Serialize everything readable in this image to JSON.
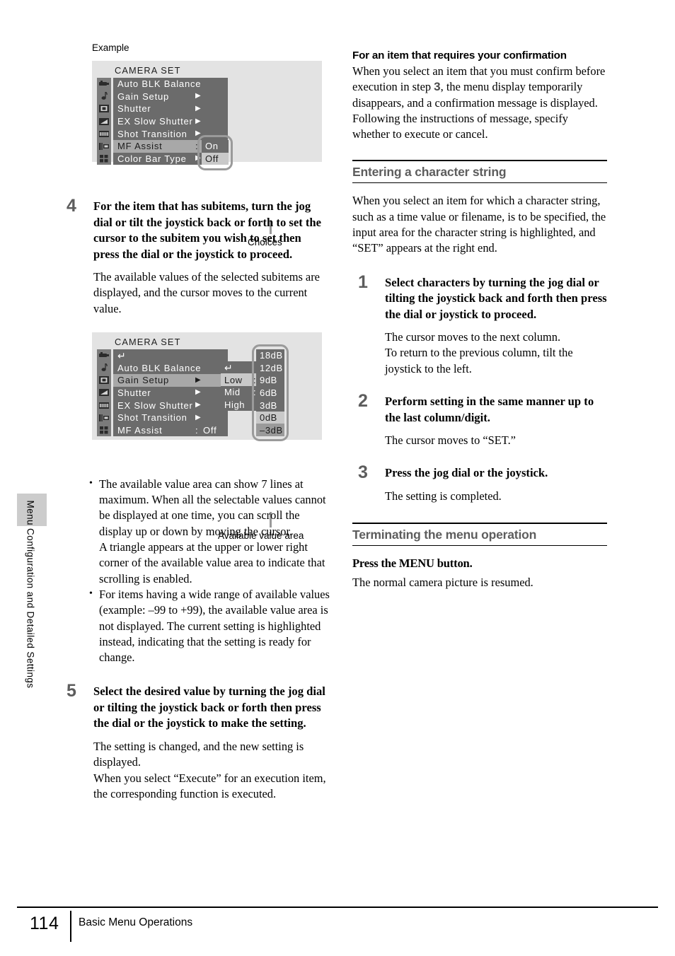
{
  "sidebar": {
    "chapter_label": "Menu Configuration and Detailed Settings"
  },
  "left_column": {
    "example_label": "Example",
    "choices_label": "Choices",
    "available_value_label": "Available value area",
    "step4": {
      "number": "4",
      "title": "For the item that has subitems, turn the jog dial or tilt the joystick back or forth to set the cursor to the subitem you wish to set then press the dial or the joystick to proceed.",
      "body": "The available values of the selected subitems are displayed, and the cursor moves to the current value."
    },
    "bullets": [
      "The available value area can show 7 lines at maximum. When all the selectable values cannot be displayed at one time, you can scroll the display up or down by moving the cursor.\nA triangle appears at the upper or lower right corner of the available value area to indicate that scrolling is enabled.",
      "For items having a wide range of available values (example: –99 to +99), the available value area is not displayed. The current setting is highlighted instead, indicating that the setting is ready for change."
    ],
    "step5": {
      "number": "5",
      "title": "Select the desired value by turning the jog dial or tilting the joystick back or forth then press the dial or the joystick to make the setting.",
      "body": "The setting is changed, and the new setting is displayed.\nWhen you select “Execute” for an execution item, the corresponding function is executed."
    }
  },
  "osd_example": {
    "title": "CAMERA SET",
    "icons": [
      "camera-icon",
      "audio-note-icon",
      "video-icon",
      "lcd-icon",
      "film-icon",
      "file-icon",
      "grid-icon"
    ],
    "rows": [
      {
        "label": "Auto BLK Balance",
        "arrow": "",
        "colon": "",
        "value": "",
        "highlight": false
      },
      {
        "label": "Gain Setup",
        "arrow": "▶",
        "colon": "",
        "value": "",
        "highlight": false
      },
      {
        "label": "Shutter",
        "arrow": "▶",
        "colon": "",
        "value": "",
        "highlight": false
      },
      {
        "label": "EX Slow Shutter",
        "arrow": "▶",
        "colon": "",
        "value": "",
        "highlight": false
      },
      {
        "label": "Shot Transition",
        "arrow": "▶",
        "colon": "",
        "value": "",
        "highlight": false
      },
      {
        "label": "MF Assist",
        "arrow": "",
        "colon": ":",
        "value": "",
        "highlight": true
      },
      {
        "label": "Color Bar Type",
        "arrow": "▶",
        "colon": "",
        "value": "",
        "highlight": false
      }
    ],
    "choices": [
      {
        "label": "On",
        "state": "normal"
      },
      {
        "label": "Off",
        "state": "selected"
      }
    ]
  },
  "osd_values": {
    "title": "CAMERA SET",
    "icons": [
      "camera-icon",
      "audio-note-icon",
      "video-icon",
      "lcd-icon",
      "film-icon",
      "file-icon",
      "grid-icon"
    ],
    "rows": [
      {
        "label": "↵",
        "arrow": "",
        "colon": "",
        "value": "",
        "highlight": false,
        "is_return": true
      },
      {
        "label": "Auto BLK Balance",
        "arrow": "",
        "colon": "",
        "value": "",
        "highlight": false
      },
      {
        "label": "Gain Setup",
        "arrow": "▶",
        "colon": "",
        "value": "",
        "highlight": true
      },
      {
        "label": "Shutter",
        "arrow": "▶",
        "colon": "",
        "value": "",
        "highlight": false
      },
      {
        "label": "EX Slow Shutter",
        "arrow": "▶",
        "colon": "",
        "value": "",
        "highlight": false
      },
      {
        "label": "Shot Transition",
        "arrow": "▶",
        "colon": "",
        "value": "",
        "highlight": false
      },
      {
        "label": "MF Assist",
        "arrow": "",
        "colon": ":",
        "value": "Off",
        "highlight": false
      }
    ],
    "submenu": [
      {
        "label": "↵",
        "colon": "",
        "highlight": false,
        "is_return": true
      },
      {
        "label": "Low",
        "colon": ":",
        "highlight": true
      },
      {
        "label": "Mid",
        "colon": ":",
        "highlight": false
      },
      {
        "label": "High",
        "colon": "",
        "highlight": false
      }
    ],
    "values": [
      {
        "label": "18dB",
        "state": "normal"
      },
      {
        "label": "12dB",
        "state": "normal"
      },
      {
        "label": "9dB",
        "state": "normal"
      },
      {
        "label": "6dB",
        "state": "normal"
      },
      {
        "label": "3dB",
        "state": "normal"
      },
      {
        "label": "0dB",
        "state": "selected"
      },
      {
        "label": "–3dB",
        "state": "cursor"
      }
    ]
  },
  "right_column": {
    "confirm": {
      "heading": "For an item that requires your confirmation",
      "body_pre": "When you select an item that you must confirm before execution in step ",
      "body_step": "3",
      "body_post": ", the menu display temporarily disappears, and a confirmation message is displayed. Following the instructions of message, specify whether to execute or cancel."
    },
    "char_string": {
      "heading": "Entering a character string",
      "intro": "When you select an item for which a character string, such as a time value or filename, is to be specified, the input area for the character string is highlighted, and “SET” appears at the right end.",
      "steps": [
        {
          "number": "1",
          "title": "Select characters by turning the jog dial or tilting the joystick back and forth then press the dial or joystick to proceed.",
          "body": "The cursor moves to the next column.\nTo return to the previous column, tilt the joystick to the left."
        },
        {
          "number": "2",
          "title": "Perform setting in the same manner up to the last column/digit.",
          "body": "The cursor moves to “SET.”"
        },
        {
          "number": "3",
          "title": "Press the jog dial or the joystick.",
          "body": "The setting is completed."
        }
      ]
    },
    "terminate": {
      "heading": "Terminating the menu operation",
      "action": "Press the MENU button.",
      "body": "The normal camera picture is resumed."
    }
  },
  "footer": {
    "page_number": "114",
    "section_title": "Basic Menu Operations"
  }
}
